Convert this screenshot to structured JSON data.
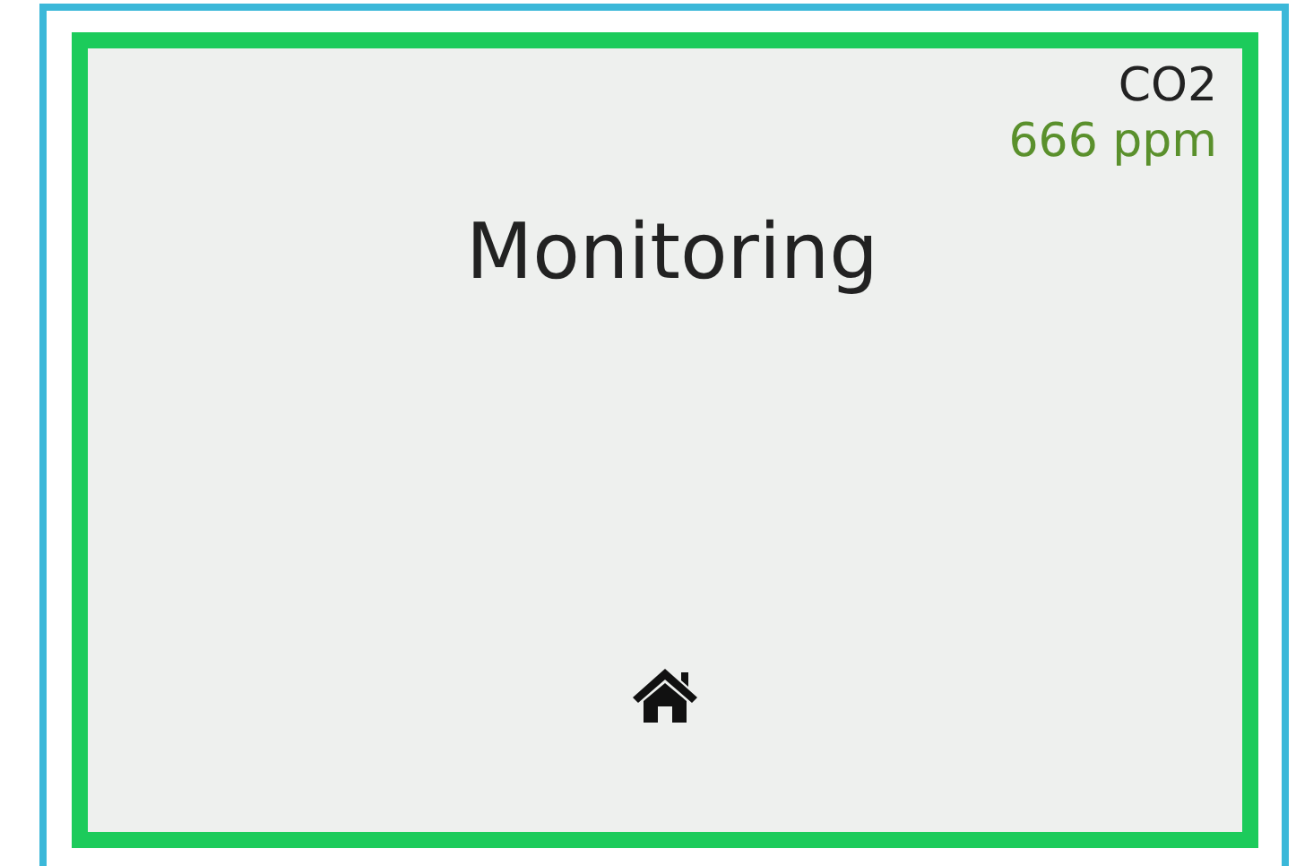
{
  "sensor": {
    "label": "CO2",
    "reading": "666 ppm"
  },
  "title": "Monitoring"
}
